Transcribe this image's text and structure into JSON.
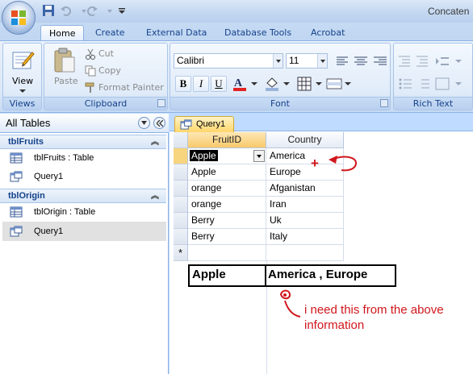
{
  "window": {
    "title": "Concaten"
  },
  "ribbon_tabs": [
    {
      "label": "Home",
      "active": true
    },
    {
      "label": "Create",
      "active": false
    },
    {
      "label": "External Data",
      "active": false
    },
    {
      "label": "Database Tools",
      "active": false
    },
    {
      "label": "Acrobat",
      "active": false
    }
  ],
  "ribbon": {
    "views": {
      "group_label": "Views",
      "view_label": "View"
    },
    "clipboard": {
      "group_label": "Clipboard",
      "paste_label": "Paste",
      "cut_label": "Cut",
      "copy_label": "Copy",
      "format_painter_label": "Format Painter"
    },
    "font": {
      "group_label": "Font",
      "font_name": "Calibri",
      "font_size": "11",
      "bold": "B",
      "italic": "I",
      "underline": "U"
    },
    "rich_text": {
      "group_label": "Rich Text"
    }
  },
  "nav_pane": {
    "header": "All Tables",
    "groups": [
      {
        "title": "tblFruits",
        "items": [
          {
            "label": "tblFruits : Table",
            "icon": "table-icon"
          },
          {
            "label": "Query1",
            "icon": "query-icon"
          }
        ]
      },
      {
        "title": "tblOrigin",
        "items": [
          {
            "label": "tblOrigin : Table",
            "icon": "table-icon"
          },
          {
            "label": "Query1",
            "icon": "query-icon",
            "selected": true
          }
        ]
      }
    ]
  },
  "document": {
    "tab_label": "Query1",
    "columns": [
      "FruitID",
      "Country"
    ],
    "rows": [
      [
        "Apple",
        "America"
      ],
      [
        "Apple",
        "Europe"
      ],
      [
        "orange",
        "Afganistan"
      ],
      [
        "orange",
        "Iran"
      ],
      [
        "Berry",
        "Uk"
      ],
      [
        "Berry",
        "Italy"
      ]
    ],
    "new_row_marker": "*"
  },
  "annotation": {
    "desired_fruit": "Apple",
    "desired_countries": "America , Europe",
    "note_line1": "i need this from the above",
    "note_line2": "information",
    "plus_mark": "+",
    "ink_color": "#d0161c"
  }
}
